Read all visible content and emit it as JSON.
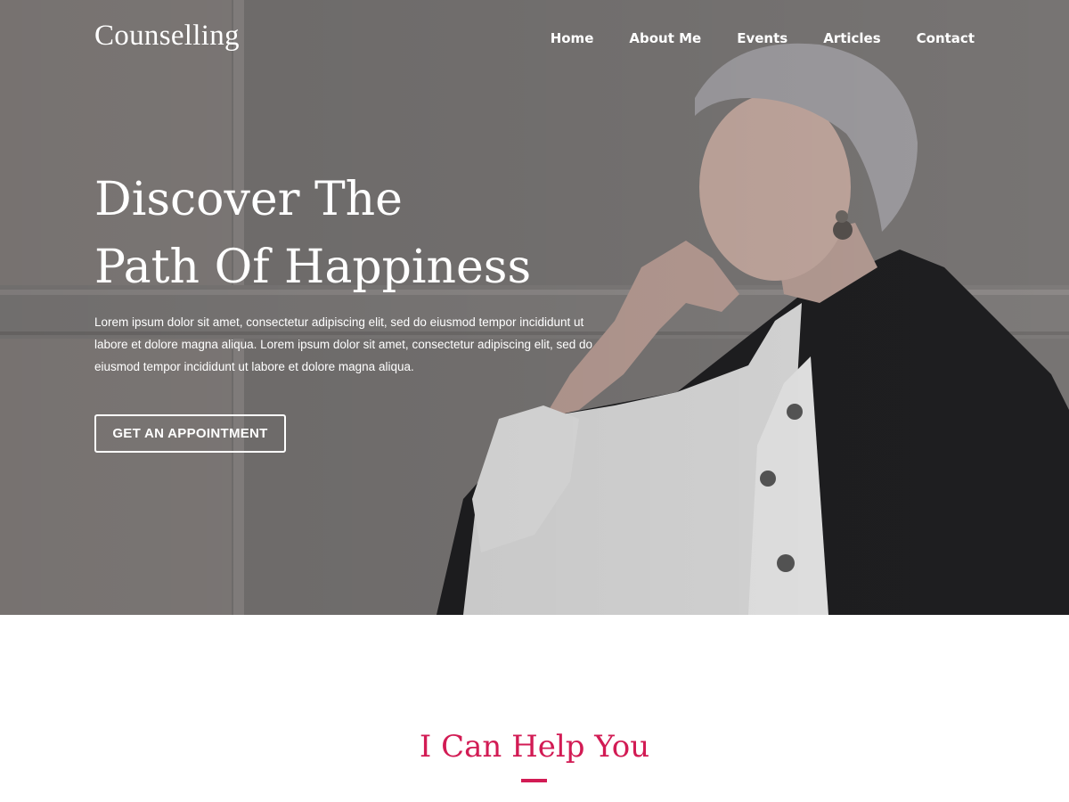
{
  "brand": {
    "logo": "Counselling"
  },
  "nav": {
    "items": [
      "Home",
      "About Me",
      "Events",
      "Articles",
      "Contact"
    ]
  },
  "hero": {
    "title_line1": "Discover The",
    "title_line2": "Path Of Happiness",
    "paragraph": "Lorem ipsum dolor sit amet, consectetur adipiscing elit, sed do eiusmod tempor incididunt ut labore et dolore magna aliqua. Lorem ipsum dolor sit amet, consectetur adipiscing elit, sed do eiusmod tempor incididunt ut labore et dolore magna aliqua.",
    "cta_label": "GET AN APPOINTMENT"
  },
  "help": {
    "title": "I Can Help You",
    "accent_color": "#d21b54"
  }
}
